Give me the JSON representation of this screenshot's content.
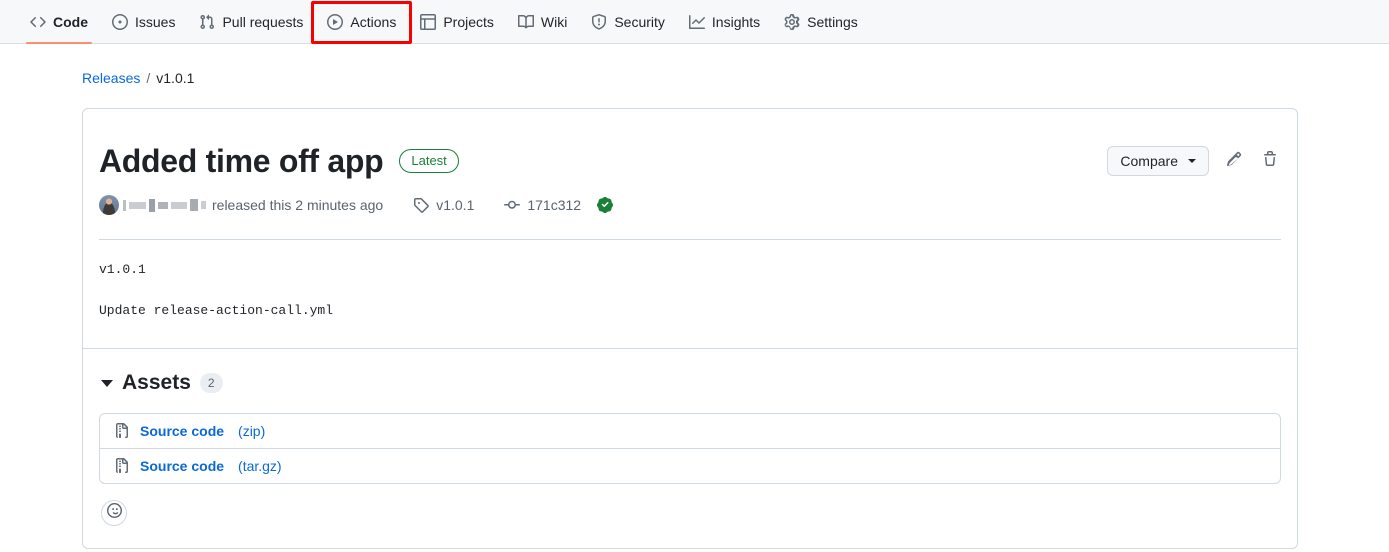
{
  "repo_nav": {
    "items": [
      {
        "label": "Code",
        "icon": "code-icon",
        "active": true
      },
      {
        "label": "Issues",
        "icon": "issue-opened-icon",
        "active": false
      },
      {
        "label": "Pull requests",
        "icon": "git-pull-request-icon",
        "active": false
      },
      {
        "label": "Actions",
        "icon": "play-icon",
        "active": false,
        "highlighted": true
      },
      {
        "label": "Projects",
        "icon": "table-icon",
        "active": false
      },
      {
        "label": "Wiki",
        "icon": "book-icon",
        "active": false
      },
      {
        "label": "Security",
        "icon": "shield-icon",
        "active": false
      },
      {
        "label": "Insights",
        "icon": "graph-icon",
        "active": false
      },
      {
        "label": "Settings",
        "icon": "gear-icon",
        "active": false
      }
    ],
    "highlight_color": "#f80000",
    "active_underline_color": "#fd8c73"
  },
  "breadcrumb": {
    "root_label": "Releases",
    "separator": "/",
    "current_label": "v1.0.1"
  },
  "release": {
    "title": "Added time off app",
    "latest_badge": "Latest",
    "compare_label": "Compare",
    "edit_icon": "pencil-icon",
    "delete_icon": "trash-icon",
    "author_name_redacted": true,
    "released_text": "released this 2 minutes ago",
    "tag_label": "v1.0.1",
    "commit_sha": "171c312",
    "verified_icon": "verified-check-icon",
    "body_lines": [
      "v1.0.1",
      "Update release-action-call.yml"
    ]
  },
  "assets": {
    "title": "Assets",
    "count": "2",
    "items": [
      {
        "name": "Source code",
        "ext": "(zip)",
        "icon": "file-zip-icon"
      },
      {
        "name": "Source code",
        "ext": "(tar.gz)",
        "icon": "file-zip-icon"
      }
    ]
  },
  "reactions": {
    "add_reaction_icon": "smiley-icon"
  },
  "colors": {
    "link": "#0969da",
    "green": "#1a7f37",
    "muted": "#59636e",
    "border": "#d1d9e0"
  }
}
